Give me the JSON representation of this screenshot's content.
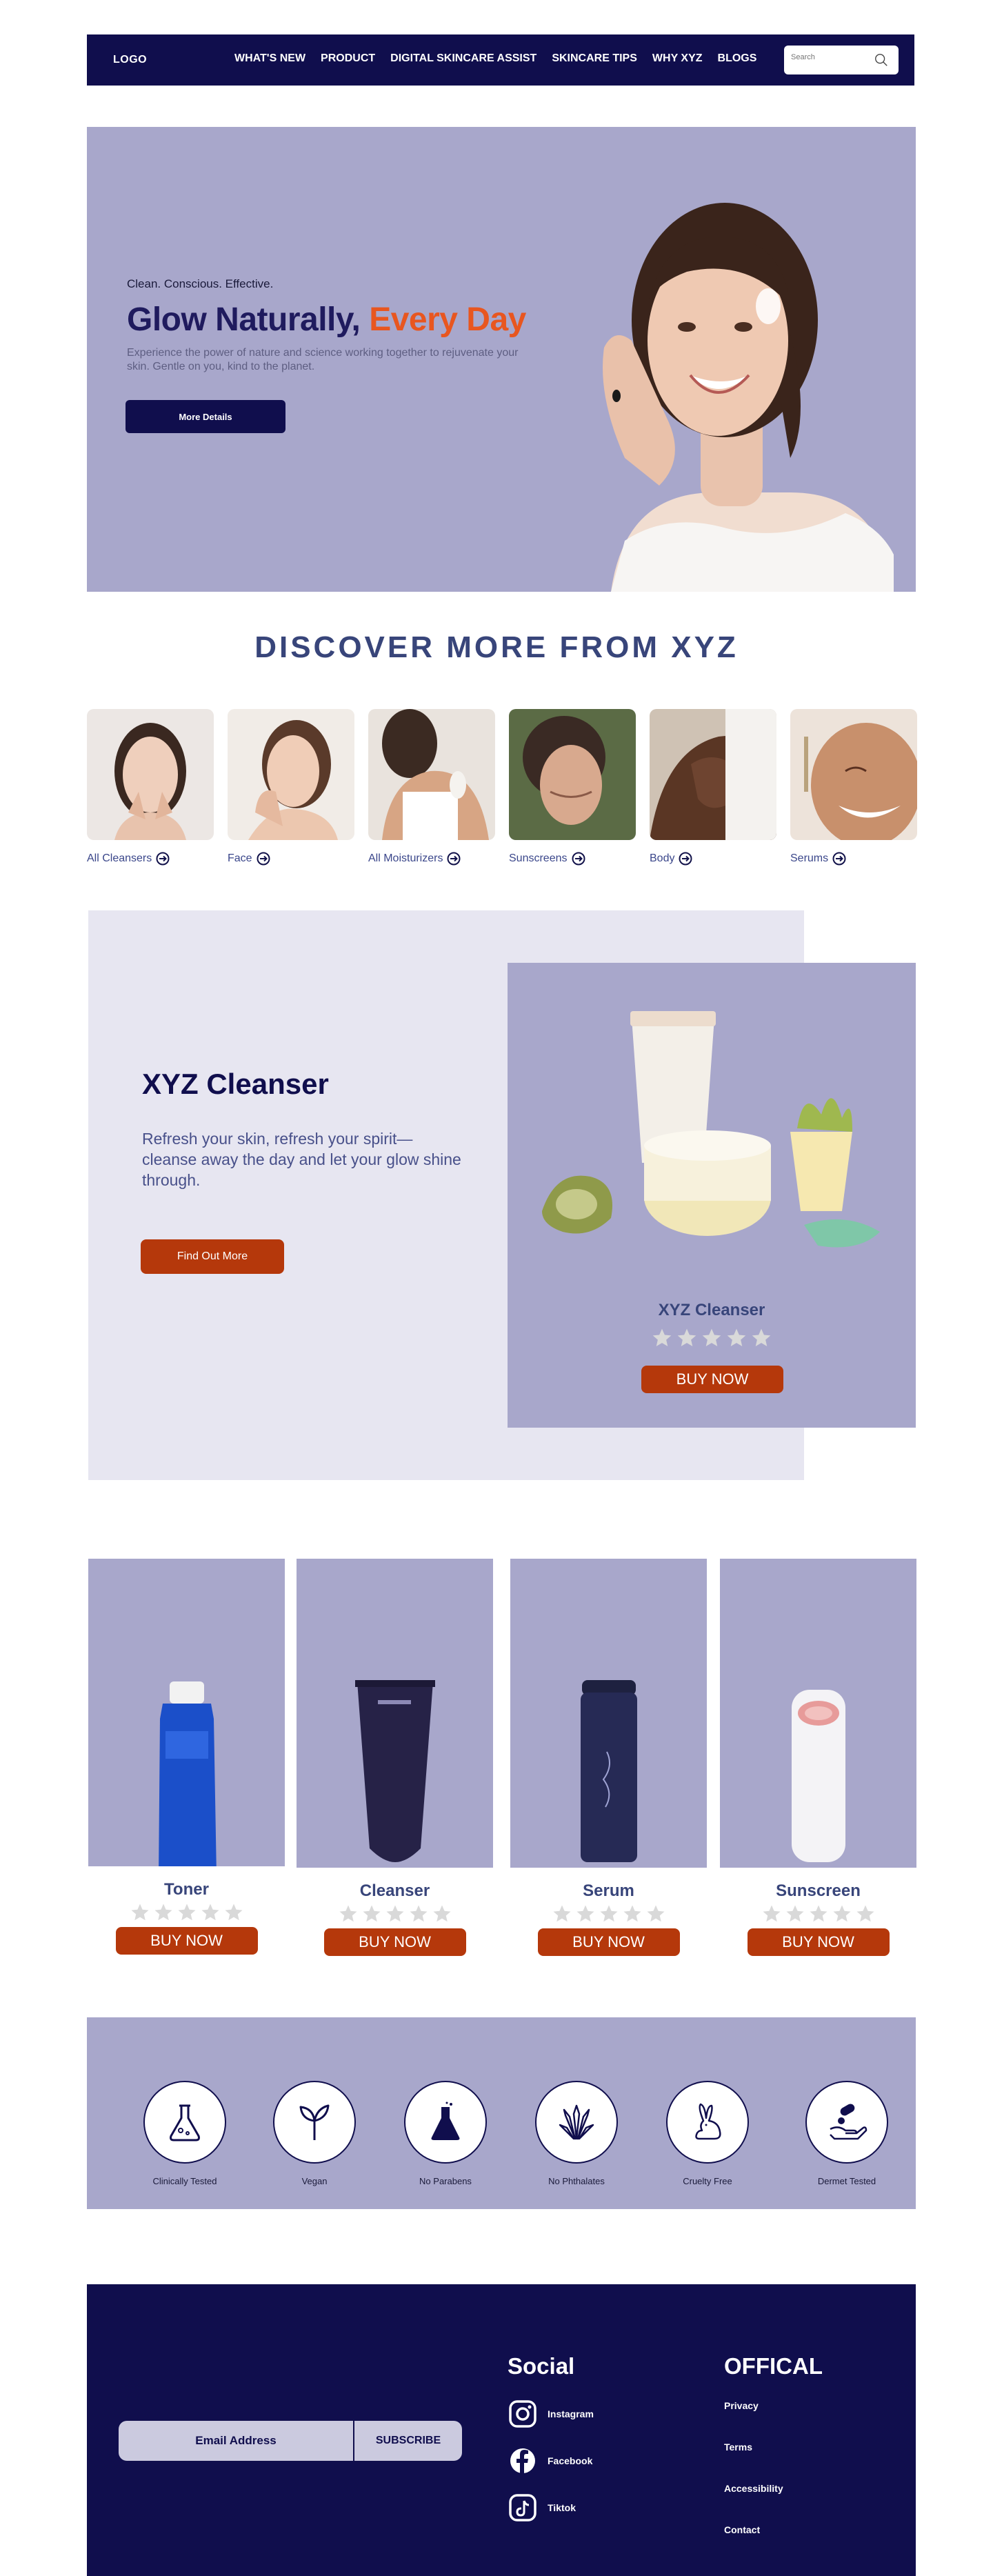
{
  "nav": {
    "logo": "LOGO",
    "links": [
      "WHAT'S NEW",
      "PRODUCT",
      "DIGITAL SKINCARE ASSIST",
      "SKINCARE TIPS",
      "WHY XYZ",
      "BLOGS"
    ],
    "search_placeholder": "Search"
  },
  "hero": {
    "tagline": "Clean. Conscious. Effective.",
    "title_main": "Glow Naturally, ",
    "title_accent": "Every Day",
    "description": "Experience the power of nature and science working together to rejuvenate your skin. Gentle on you, kind to the planet.",
    "button": "More Details"
  },
  "discover": {
    "title": "DISCOVER MORE FROM XYZ",
    "categories": [
      "All Cleansers",
      "Face",
      "All Moisturizers",
      "Sunscreens",
      "Body",
      "Serums"
    ]
  },
  "feature": {
    "title": "XYZ Cleanser",
    "description": "Refresh your skin, refresh your spirit—cleanse away the day and let your glow shine through.",
    "button": "Find Out More",
    "card_name": "XYZ Cleanser",
    "card_button": "BUY NOW"
  },
  "products": [
    {
      "name": "Toner",
      "button": "BUY NOW"
    },
    {
      "name": "Cleanser",
      "button": "BUY NOW"
    },
    {
      "name": "Serum",
      "button": "BUY NOW"
    },
    {
      "name": "Sunscreen",
      "button": "BUY NOW"
    }
  ],
  "badges": [
    "Clinically Tested",
    "Vegan",
    "No Parabens",
    "No Phthalates",
    "Cruelty Free",
    "Dermet Tested"
  ],
  "footer": {
    "email_placeholder": "Email Address",
    "subscribe": "SUBSCRIBE",
    "social_heading": "Social",
    "social": [
      "Instagram",
      "Facebook",
      "Tiktok"
    ],
    "official_heading": "OFFICAL",
    "official": [
      "Privacy",
      "Terms",
      "Accessibility",
      "Contact"
    ]
  },
  "colors": {
    "navy": "#100e4d",
    "lavender": "#a8a7cb",
    "light_lavender": "#e7e6f1",
    "orange_accent": "#e8561f",
    "buy_button": "#b5380b",
    "heading_blue": "#38457a"
  }
}
